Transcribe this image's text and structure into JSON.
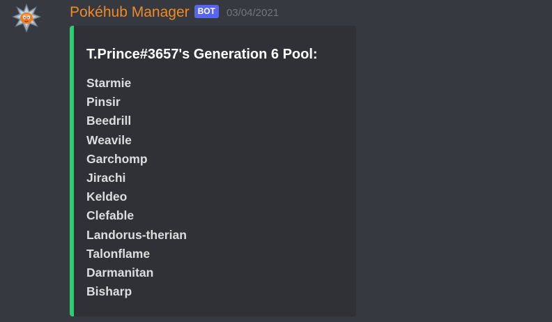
{
  "message": {
    "author": "Pokéhub Manager",
    "bot_tag": "BOT",
    "timestamp": "03/04/2021",
    "avatar_icon": "rotom-avatar-icon",
    "author_color": "#f08a24",
    "embed": {
      "accent_color": "#2ecc71",
      "title": "T.Prince#3657's Generation 6 Pool:",
      "pool": [
        "Starmie",
        "Pinsir",
        "Beedrill",
        "Weavile",
        "Garchomp",
        "Jirachi",
        "Keldeo",
        "Clefable",
        "Landorus-therian",
        "Talonflame",
        "Darmanitan",
        "Bisharp"
      ]
    }
  }
}
